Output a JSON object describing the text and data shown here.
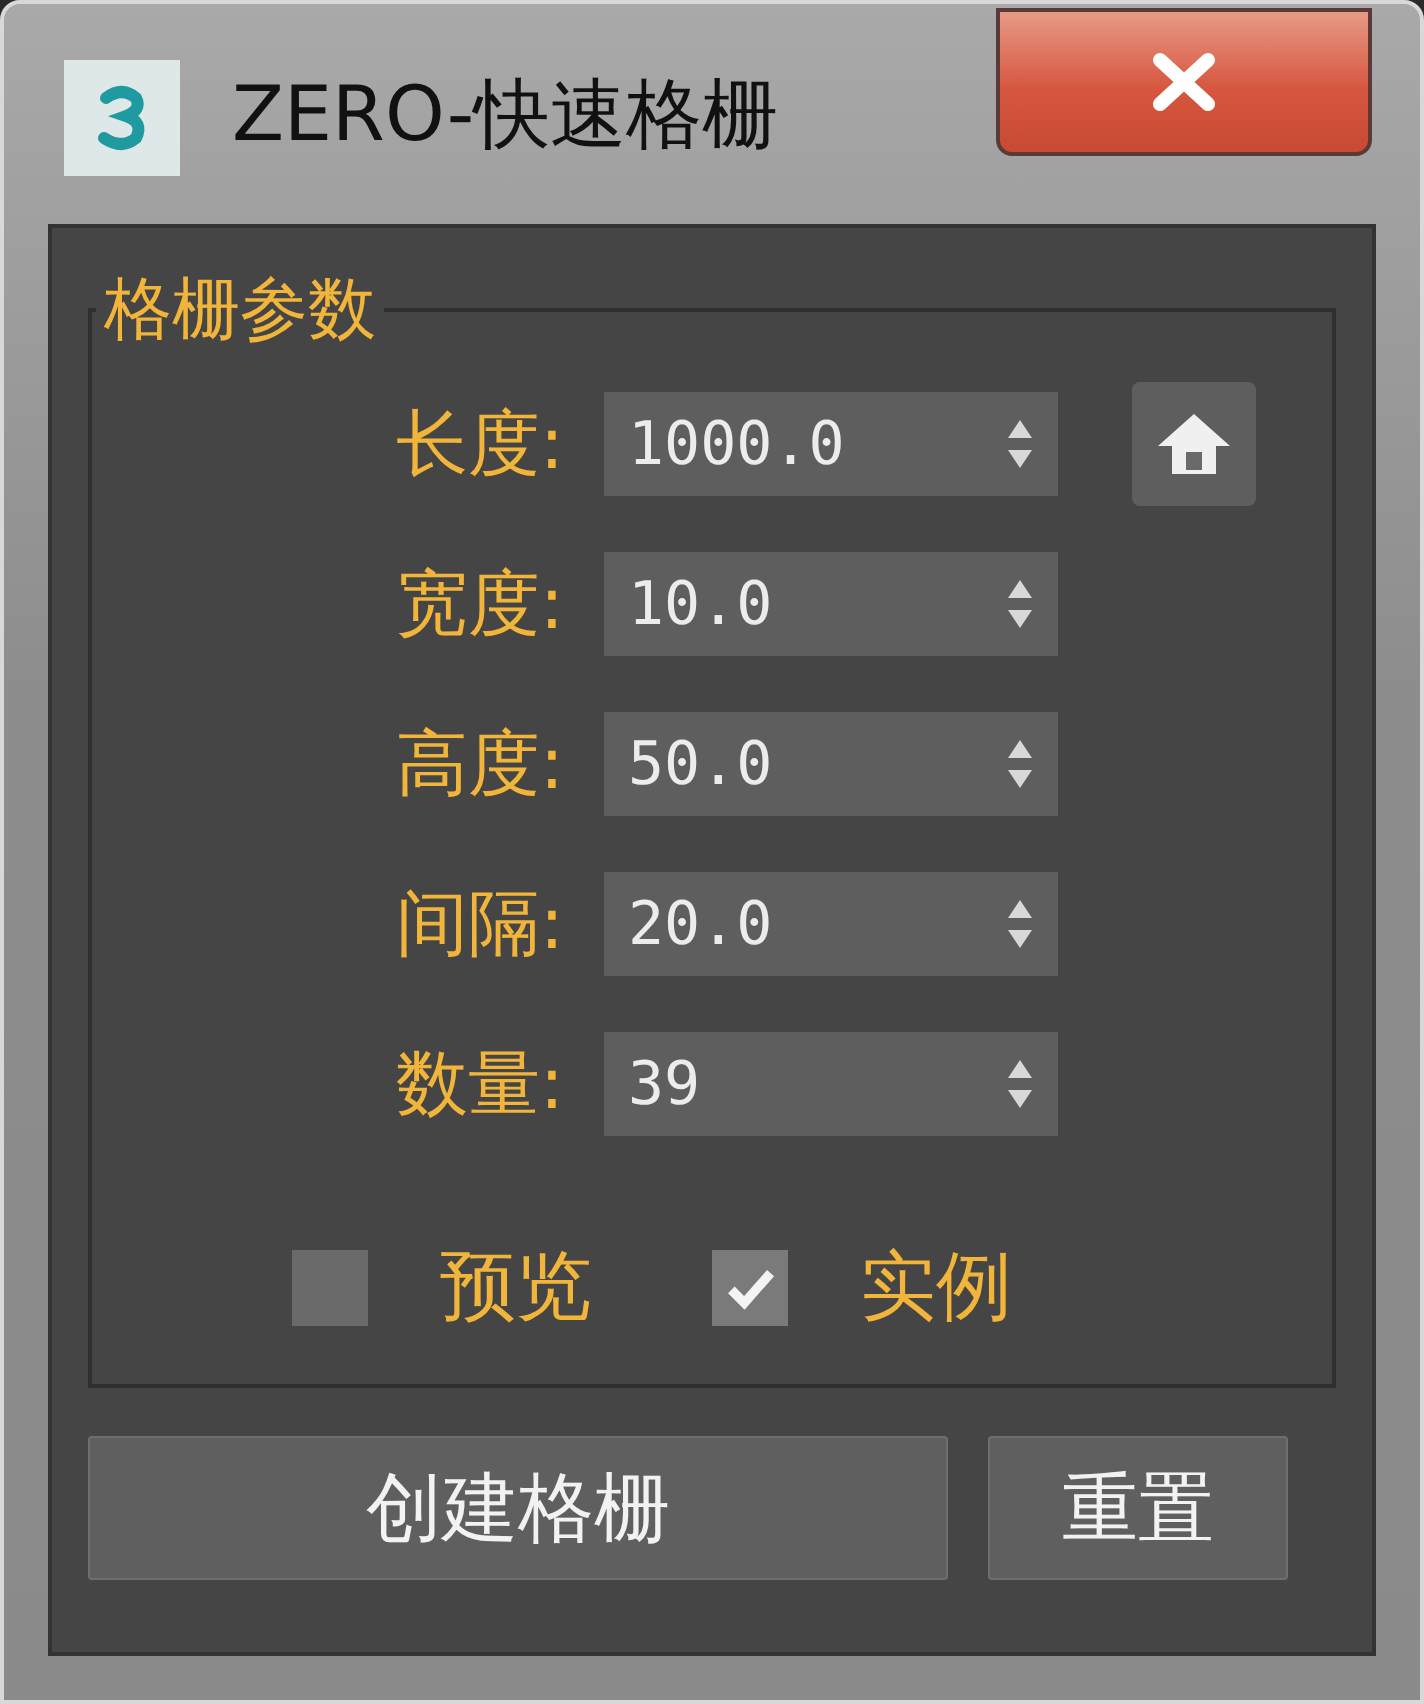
{
  "window": {
    "title": "ZERO-快速格栅"
  },
  "group": {
    "title": "格栅参数"
  },
  "fields": [
    {
      "label": "长度:",
      "value": "1000.0"
    },
    {
      "label": "宽度:",
      "value": "10.0"
    },
    {
      "label": "高度:",
      "value": "50.0"
    },
    {
      "label": "间隔:",
      "value": "20.0"
    },
    {
      "label": "数量:",
      "value": "39"
    }
  ],
  "options": [
    {
      "label": "预览",
      "checked": false
    },
    {
      "label": "实例",
      "checked": true
    }
  ],
  "buttons": [
    "创建格栅",
    "重置"
  ]
}
